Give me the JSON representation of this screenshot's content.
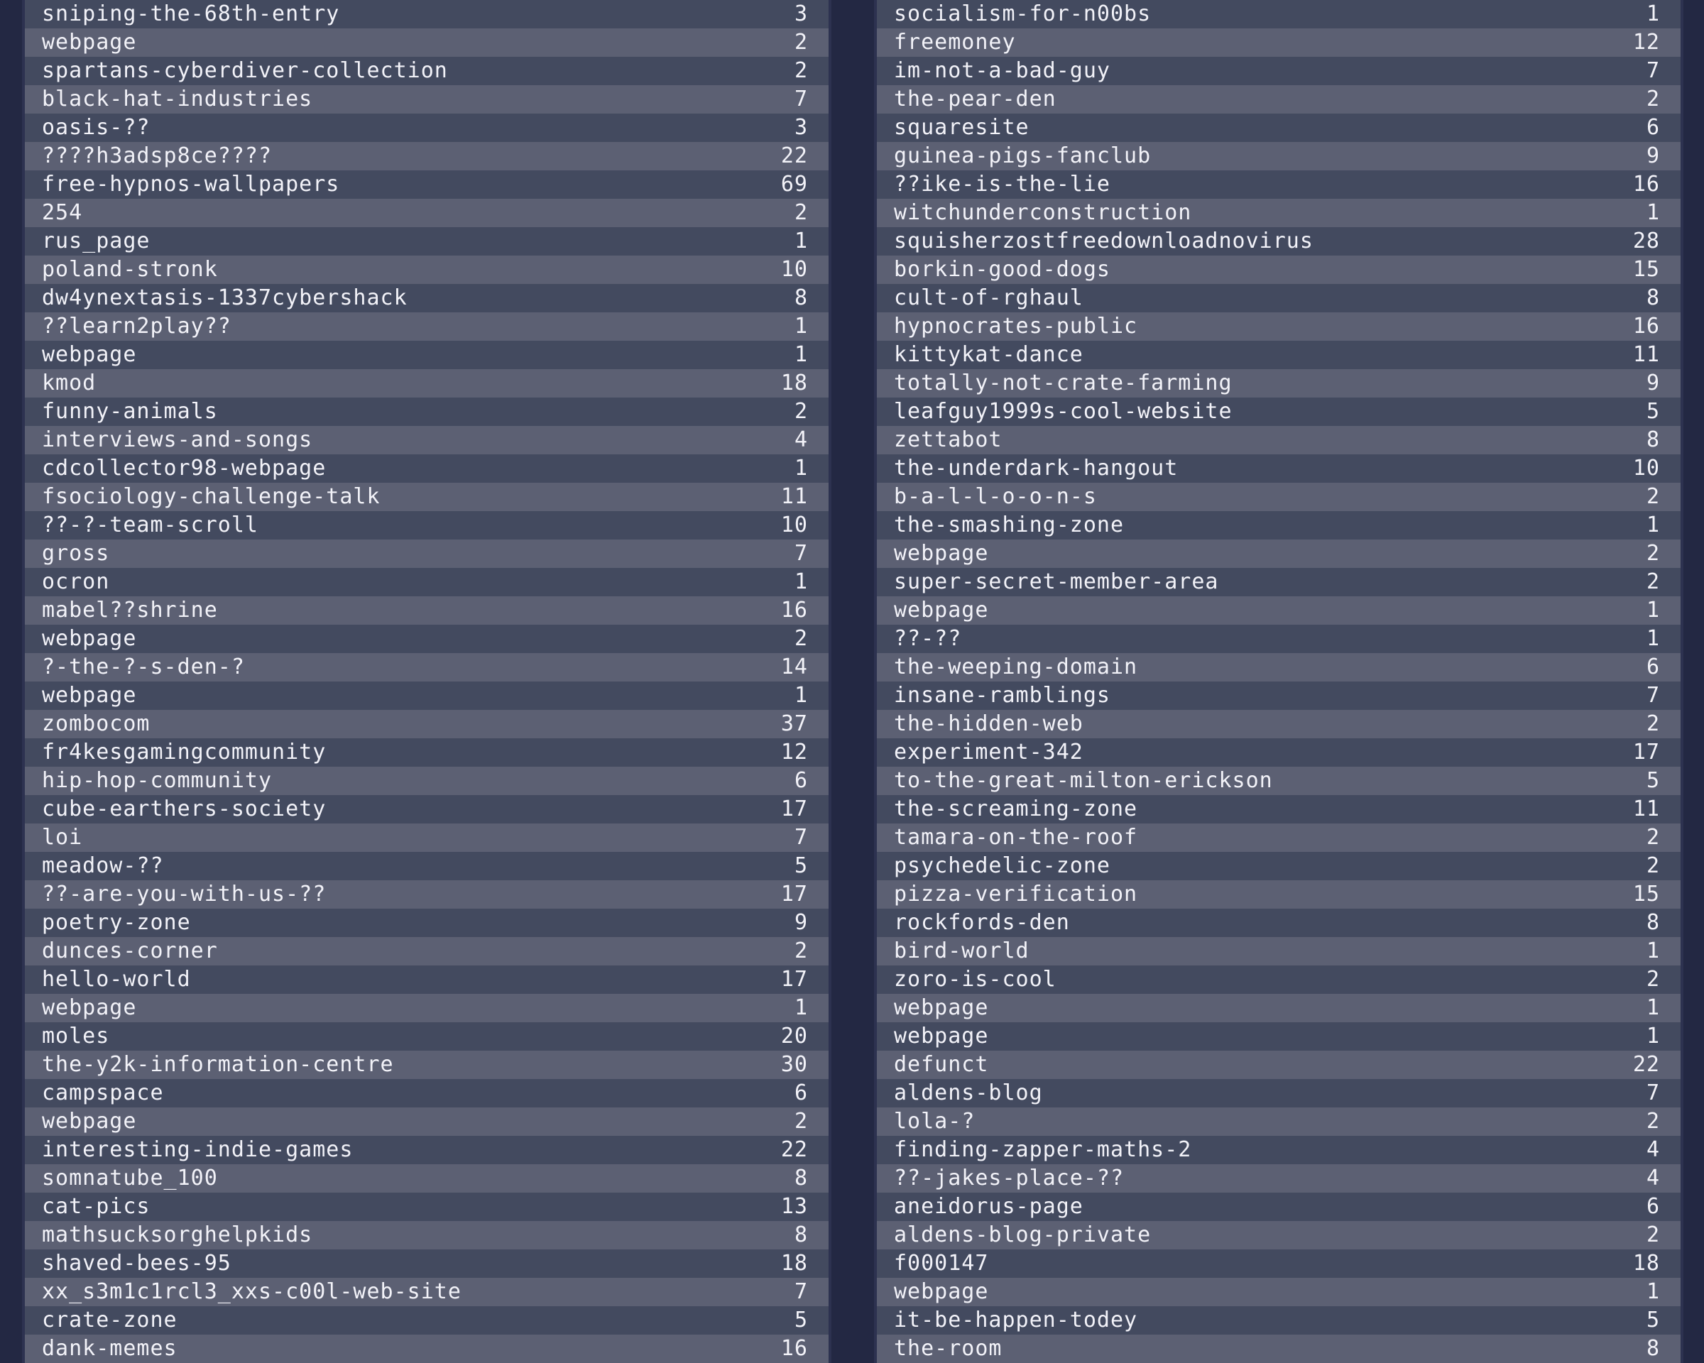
{
  "columns": [
    {
      "rows": [
        {
          "name": "sniping-the-68th-entry",
          "count": "3"
        },
        {
          "name": "webpage",
          "count": "2"
        },
        {
          "name": "spartans-cyberdiver-collection",
          "count": "2"
        },
        {
          "name": "black-hat-industries",
          "count": "7"
        },
        {
          "name": "oasis-??",
          "count": "3"
        },
        {
          "name": "????h3adsp8ce????",
          "count": "22"
        },
        {
          "name": "free-hypnos-wallpapers",
          "count": "69"
        },
        {
          "name": "254",
          "count": "2"
        },
        {
          "name": "rus_page",
          "count": "1"
        },
        {
          "name": "poland-stronk",
          "count": "10"
        },
        {
          "name": "dw4ynextasis-1337cybershack",
          "count": "8"
        },
        {
          "name": "??learn2play??",
          "count": "1"
        },
        {
          "name": "webpage",
          "count": "1"
        },
        {
          "name": "kmod",
          "count": "18"
        },
        {
          "name": "funny-animals",
          "count": "2"
        },
        {
          "name": "interviews-and-songs",
          "count": "4"
        },
        {
          "name": "cdcollector98-webpage",
          "count": "1"
        },
        {
          "name": "fsociology-challenge-talk",
          "count": "11"
        },
        {
          "name": "??-?-team-scroll",
          "count": "10"
        },
        {
          "name": "gross",
          "count": "7"
        },
        {
          "name": "ocron",
          "count": "1"
        },
        {
          "name": "mabel??shrine",
          "count": "16"
        },
        {
          "name": "webpage",
          "count": "2"
        },
        {
          "name": "?-the-?-s-den-?",
          "count": "14"
        },
        {
          "name": "webpage",
          "count": "1"
        },
        {
          "name": "zombocom",
          "count": "37"
        },
        {
          "name": "fr4kesgamingcommunity",
          "count": "12"
        },
        {
          "name": "hip-hop-community",
          "count": "6"
        },
        {
          "name": "cube-earthers-society",
          "count": "17"
        },
        {
          "name": "loi",
          "count": "7"
        },
        {
          "name": "meadow-??",
          "count": "5"
        },
        {
          "name": "??-are-you-with-us-??",
          "count": "17"
        },
        {
          "name": "poetry-zone",
          "count": "9"
        },
        {
          "name": "dunces-corner",
          "count": "2"
        },
        {
          "name": "hello-world",
          "count": "17"
        },
        {
          "name": "webpage",
          "count": "1"
        },
        {
          "name": "moles",
          "count": "20"
        },
        {
          "name": "the-y2k-information-centre",
          "count": "30"
        },
        {
          "name": "campspace",
          "count": "6"
        },
        {
          "name": "webpage",
          "count": "2"
        },
        {
          "name": "interesting-indie-games",
          "count": "22"
        },
        {
          "name": "somnatube_100",
          "count": "8"
        },
        {
          "name": "cat-pics",
          "count": "13"
        },
        {
          "name": "mathsucksorghelpkids",
          "count": "8"
        },
        {
          "name": "shaved-bees-95",
          "count": "18"
        },
        {
          "name": "xx_s3m1c1rcl3_xxs-c00l-web-site",
          "count": "7"
        },
        {
          "name": "crate-zone",
          "count": "5"
        },
        {
          "name": "dank-memes",
          "count": "16"
        }
      ]
    },
    {
      "rows": [
        {
          "name": "socialism-for-n00bs",
          "count": "1"
        },
        {
          "name": "freemoney",
          "count": "12"
        },
        {
          "name": "im-not-a-bad-guy",
          "count": "7"
        },
        {
          "name": "the-pear-den",
          "count": "2"
        },
        {
          "name": "squaresite",
          "count": "6"
        },
        {
          "name": "guinea-pigs-fanclub",
          "count": "9"
        },
        {
          "name": "??ike-is-the-lie",
          "count": "16"
        },
        {
          "name": "witchunderconstruction",
          "count": "1"
        },
        {
          "name": "squisherzostfreedownloadnovirus",
          "count": "28"
        },
        {
          "name": "borkin-good-dogs",
          "count": "15"
        },
        {
          "name": "cult-of-rghaul",
          "count": "8"
        },
        {
          "name": "hypnocrates-public",
          "count": "16"
        },
        {
          "name": "kittykat-dance",
          "count": "11"
        },
        {
          "name": "totally-not-crate-farming",
          "count": "9"
        },
        {
          "name": "leafguy1999s-cool-website",
          "count": "5"
        },
        {
          "name": "zettabot",
          "count": "8"
        },
        {
          "name": "the-underdark-hangout",
          "count": "10"
        },
        {
          "name": "b-a-l-l-o-o-n-s",
          "count": "2"
        },
        {
          "name": "the-smashing-zone",
          "count": "1"
        },
        {
          "name": "webpage",
          "count": "2"
        },
        {
          "name": "super-secret-member-area",
          "count": "2"
        },
        {
          "name": "webpage",
          "count": "1"
        },
        {
          "name": "??-??",
          "count": "1"
        },
        {
          "name": "the-weeping-domain",
          "count": "6"
        },
        {
          "name": "insane-ramblings",
          "count": "7"
        },
        {
          "name": "the-hidden-web",
          "count": "2"
        },
        {
          "name": "experiment-342",
          "count": "17"
        },
        {
          "name": "to-the-great-milton-erickson",
          "count": "5"
        },
        {
          "name": "the-screaming-zone",
          "count": "11"
        },
        {
          "name": "tamara-on-the-roof",
          "count": "2"
        },
        {
          "name": "psychedelic-zone",
          "count": "2"
        },
        {
          "name": "pizza-verification",
          "count": "15"
        },
        {
          "name": "rockfords-den",
          "count": "8"
        },
        {
          "name": "bird-world",
          "count": "1"
        },
        {
          "name": "zoro-is-cool",
          "count": "2"
        },
        {
          "name": "webpage",
          "count": "1"
        },
        {
          "name": "webpage",
          "count": "1"
        },
        {
          "name": "defunct",
          "count": "22"
        },
        {
          "name": "aldens-blog",
          "count": "7"
        },
        {
          "name": "lola-?",
          "count": "2"
        },
        {
          "name": "finding-zapper-maths-2",
          "count": "4"
        },
        {
          "name": "??-jakes-place-??",
          "count": "4"
        },
        {
          "name": "aneidorus-page",
          "count": "6"
        },
        {
          "name": "aldens-blog-private",
          "count": "2"
        },
        {
          "name": "f000147",
          "count": "18"
        },
        {
          "name": "webpage",
          "count": "1"
        },
        {
          "name": "it-be-happen-todey",
          "count": "5"
        },
        {
          "name": "the-room",
          "count": "8"
        }
      ]
    }
  ]
}
